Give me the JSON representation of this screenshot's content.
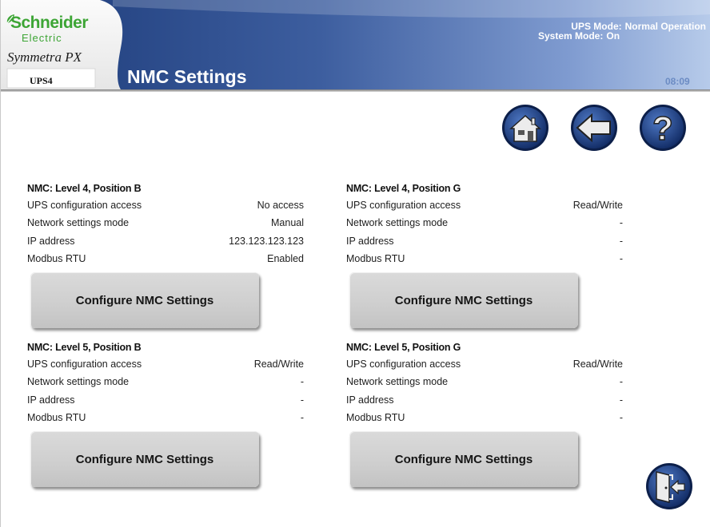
{
  "header": {
    "brand_line1": "Schneider",
    "brand_line2": "Electric",
    "product_name": "Symmetra PX",
    "unit_label": "UPS4",
    "page_title": "NMC Settings",
    "ups_mode_label": "UPS Mode:",
    "ups_mode_value": "Normal Operation",
    "system_mode_label": "System Mode:",
    "system_mode_value": "On",
    "clock": "08:09",
    "colors": {
      "banner_dark": "#1c3a78",
      "banner_light": "#a6bde3",
      "brand_green": "#3da535"
    }
  },
  "nav": {
    "home_icon": "home-icon",
    "back_icon": "back-arrow-icon",
    "help_icon": "help-icon",
    "exit_icon": "exit-door-icon"
  },
  "panels": [
    {
      "heading": "NMC: Level 4, Position B",
      "rows": [
        {
          "label": "UPS configuration access",
          "value": "No access"
        },
        {
          "label": "Network settings mode",
          "value": "Manual"
        },
        {
          "label": "IP address",
          "value": "123.123.123.123"
        },
        {
          "label": "Modbus RTU",
          "value": "Enabled"
        }
      ],
      "button_label": "Configure NMC Settings"
    },
    {
      "heading": "NMC: Level 4, Position G",
      "rows": [
        {
          "label": "UPS configuration access",
          "value": "Read/Write"
        },
        {
          "label": "Network settings mode",
          "value": "-"
        },
        {
          "label": "IP address",
          "value": "-"
        },
        {
          "label": "Modbus RTU",
          "value": "-"
        }
      ],
      "button_label": "Configure NMC Settings"
    },
    {
      "heading": "NMC: Level 5, Position B",
      "rows": [
        {
          "label": "UPS configuration access",
          "value": "Read/Write"
        },
        {
          "label": "Network settings mode",
          "value": "-"
        },
        {
          "label": "IP address",
          "value": "-"
        },
        {
          "label": "Modbus RTU",
          "value": "-"
        }
      ],
      "button_label": "Configure NMC Settings"
    },
    {
      "heading": "NMC: Level 5, Position G",
      "rows": [
        {
          "label": "UPS configuration access",
          "value": "Read/Write"
        },
        {
          "label": "Network settings mode",
          "value": "-"
        },
        {
          "label": "IP address",
          "value": "-"
        },
        {
          "label": "Modbus RTU",
          "value": "-"
        }
      ],
      "button_label": "Configure NMC Settings"
    }
  ]
}
